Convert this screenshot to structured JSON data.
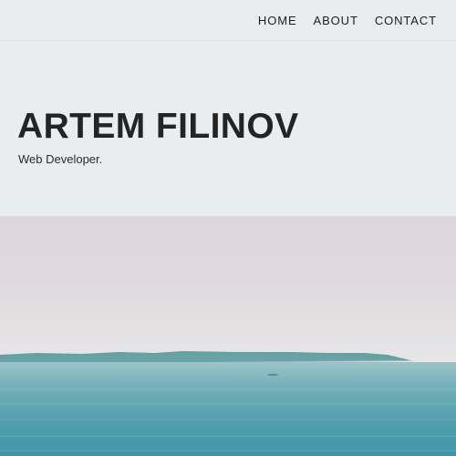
{
  "nav": {
    "items": [
      {
        "label": "HOME"
      },
      {
        "label": "ABOUT"
      },
      {
        "label": "CONTACT"
      }
    ]
  },
  "hero": {
    "name": "ARTEM FILINOV",
    "tagline": "Web Developer."
  },
  "colors": {
    "background": "#e9edf0",
    "text": "#242424",
    "sky": "#ddd6dc",
    "sea": "#4c9eab",
    "shore": "#5b9a9c"
  },
  "image": {
    "subject": "sea-landscape-photo"
  }
}
